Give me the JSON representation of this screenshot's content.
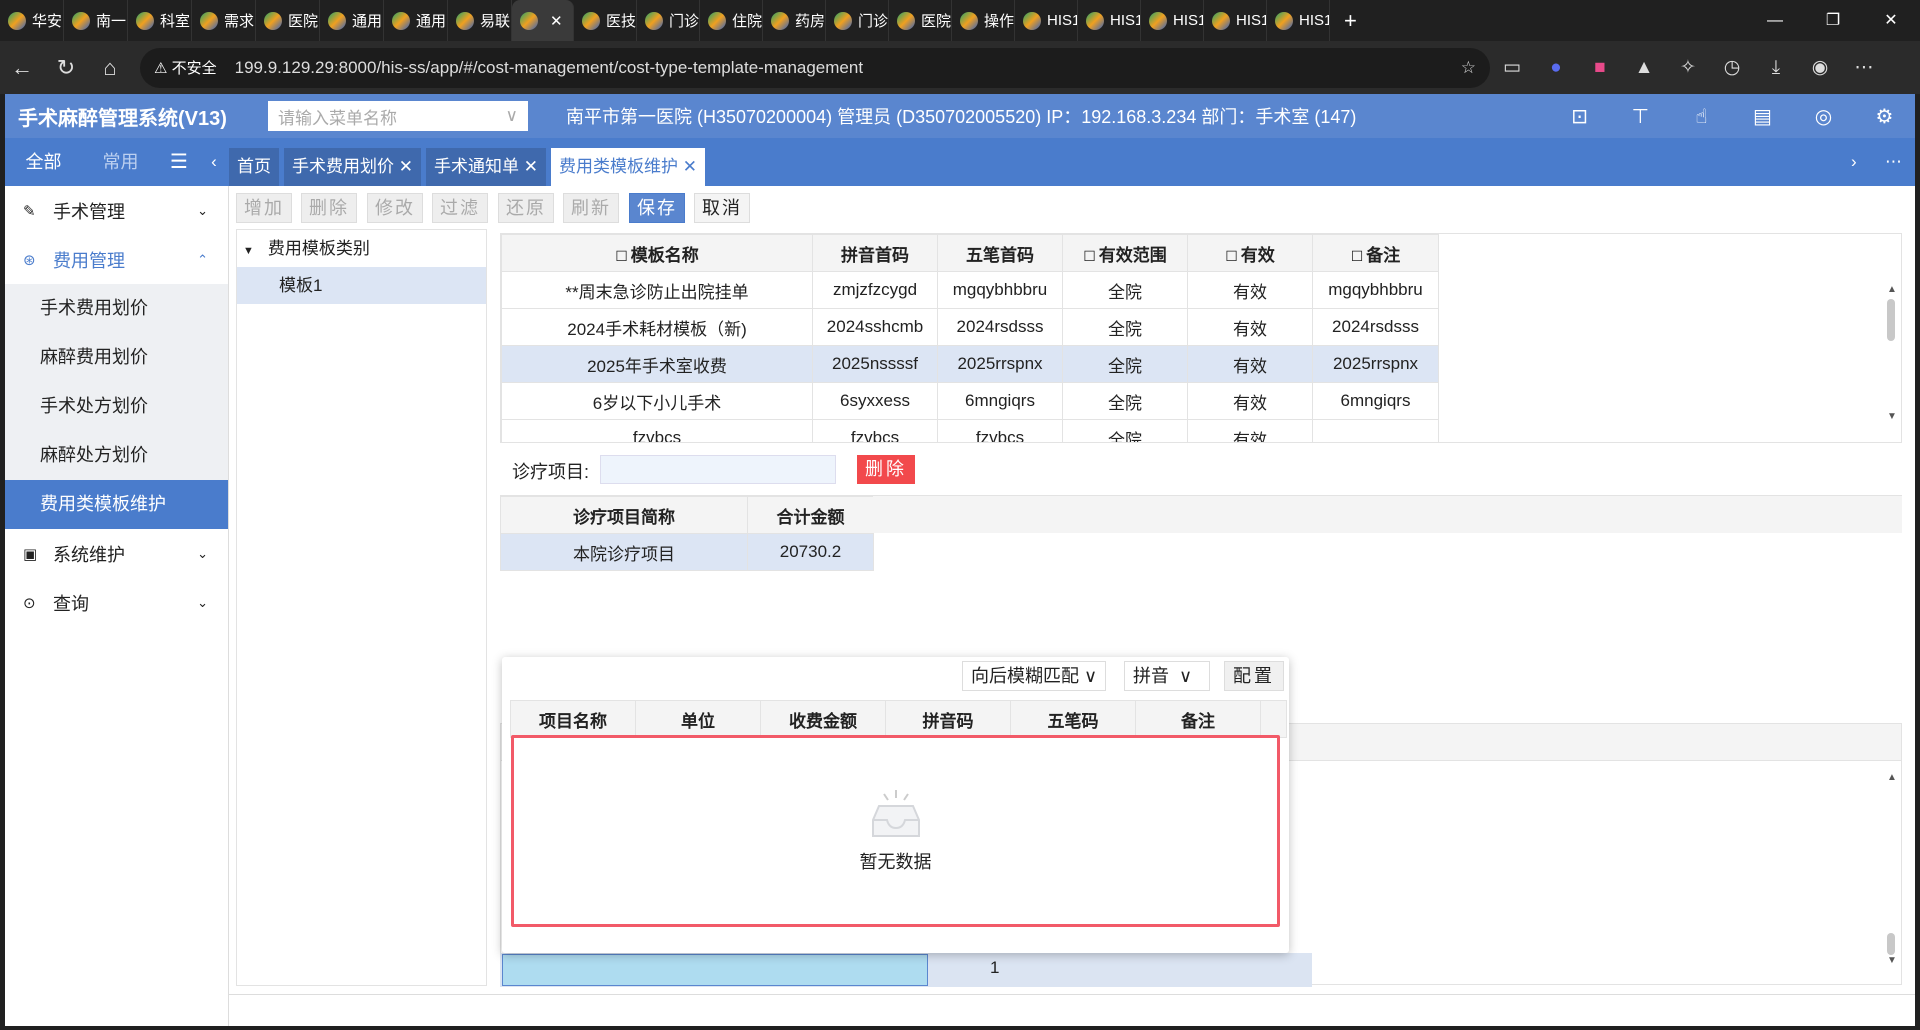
{
  "browser": {
    "tabs": [
      "华安",
      "南一",
      "科室",
      "需求",
      "医院",
      "通用",
      "通用",
      "易联",
      "",
      "医技",
      "门诊",
      "住院",
      "药房",
      "门诊",
      "医院",
      "操作",
      "HIS1",
      "HIS1",
      "HIS1",
      "HIS1",
      "HIS1"
    ],
    "active_tab_index": 8,
    "new_tab": "+",
    "security_label": "不安全",
    "url": "199.9.129.29:8000/his-ss/app/#/cost-management/cost-type-template-management"
  },
  "header": {
    "title": "手术麻醉管理系统(V13)",
    "menu_search_placeholder": "请输入菜单名称",
    "info": "南平市第一医院 (H35070200004) 管理员 (D350702005520) IP：192.168.3.234 部门：手术室 (147)",
    "icons": [
      "monitor-icon",
      "presentation-icon",
      "hand-icon",
      "document-icon",
      "eye-icon",
      "gear-icon"
    ]
  },
  "nav": {
    "tab_all": "全部",
    "tab_common": "常用"
  },
  "page_tabs": [
    {
      "label": "首页"
    },
    {
      "label": "手术费用划价"
    },
    {
      "label": "手术通知单"
    },
    {
      "label": "费用类模板维护"
    }
  ],
  "sidebar": {
    "items": [
      {
        "label": "手术管理",
        "icon": "pen-icon"
      },
      {
        "label": "费用管理",
        "icon": "cost-icon",
        "children": [
          "手术费用划价",
          "麻醉费用划价",
          "手术处方划价",
          "麻醉处方划价",
          "费用类模板维护"
        ]
      },
      {
        "label": "系统维护",
        "icon": "system-icon"
      },
      {
        "label": "查询",
        "icon": "search-icon"
      }
    ]
  },
  "toolbar": {
    "add": "增加",
    "delete": "删除",
    "edit": "修改",
    "filter": "过滤",
    "restore": "还原",
    "refresh": "刷新",
    "save": "保存",
    "cancel": "取消"
  },
  "tree": {
    "root": "费用模板类别",
    "children": [
      "模板1"
    ]
  },
  "template_grid": {
    "columns": [
      "模板名称",
      "拼音首码",
      "五笔首码",
      "有效范围",
      "有效",
      "备注"
    ],
    "rows": [
      [
        "**周末急诊防止出院挂单",
        "zmjzfzcygd",
        "mgqybhbbru",
        "全院",
        "有效",
        "mgqybhbbru"
      ],
      [
        "2024手术耗材模板（新)",
        "2024sshcmb",
        "2024rsdsss",
        "全院",
        "有效",
        "2024rsdsss"
      ],
      [
        "2025年手术室收费",
        "2025nssssf",
        "2025rrspnx",
        "全院",
        "有效",
        "2025rrspnx"
      ],
      [
        "6岁以下小儿手术",
        "6syxxess",
        "6mngiqrs",
        "全院",
        "有效",
        "6mngiqrs"
      ],
      [
        "fzvbcs",
        "fzvbcs",
        "fzvbcs",
        "全院",
        "有效",
        ""
      ]
    ]
  },
  "diagnosis": {
    "label": "诊疗项目:",
    "value": "",
    "delete": "删除"
  },
  "summary_grid": {
    "columns": [
      "诊疗项目简称",
      "合计金额"
    ],
    "rows": [
      [
        "本院诊疗项目",
        "20730.2"
      ]
    ]
  },
  "popup": {
    "match_mode": "向后模糊匹配",
    "input_mode": "拼音",
    "config": "配置",
    "columns": [
      "项目名称",
      "单位",
      "收费金额",
      "拼音码",
      "五笔码",
      "备注"
    ],
    "empty_text": "暂无数据"
  },
  "bottom_row": {
    "value": "1"
  }
}
